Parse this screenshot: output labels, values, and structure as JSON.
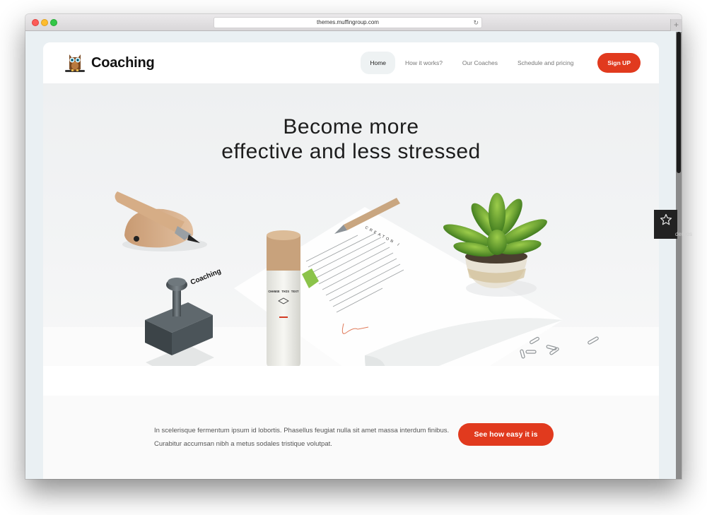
{
  "browser": {
    "url": "themes.muffingroup.com",
    "reload_icon": "↻",
    "new_tab_icon": "+"
  },
  "site": {
    "brand": "Coaching",
    "nav": [
      {
        "label": "Home",
        "active": true
      },
      {
        "label": "How it works?",
        "active": false
      },
      {
        "label": "Our Coaches",
        "active": false
      },
      {
        "label": "Schedule and pricing",
        "active": false
      }
    ],
    "signup_label": "Sign UP",
    "hero": {
      "title_line1": "Become more",
      "title_line2": "effective and less stressed",
      "illustration": {
        "stamp_text": "Coaching",
        "tube_text": "CHANGE THIS TEXT",
        "letter_heading": "CREATOR /"
      }
    },
    "intro": {
      "line1": "In scelerisque fermentum ipsum id lobortis. Phasellus feugiat nulla sit amet massa interdum finibus.",
      "line2": "Curabitur accumsan nibh a metus sodales tristique volutpat."
    },
    "cta_label": "See how easy it is"
  },
  "demos": {
    "label": "demos",
    "icon": "star-icon"
  },
  "colors": {
    "accent": "#e13a1e",
    "nav_active_bg": "#eef2f3",
    "page_bg": "#eaf0f3"
  }
}
